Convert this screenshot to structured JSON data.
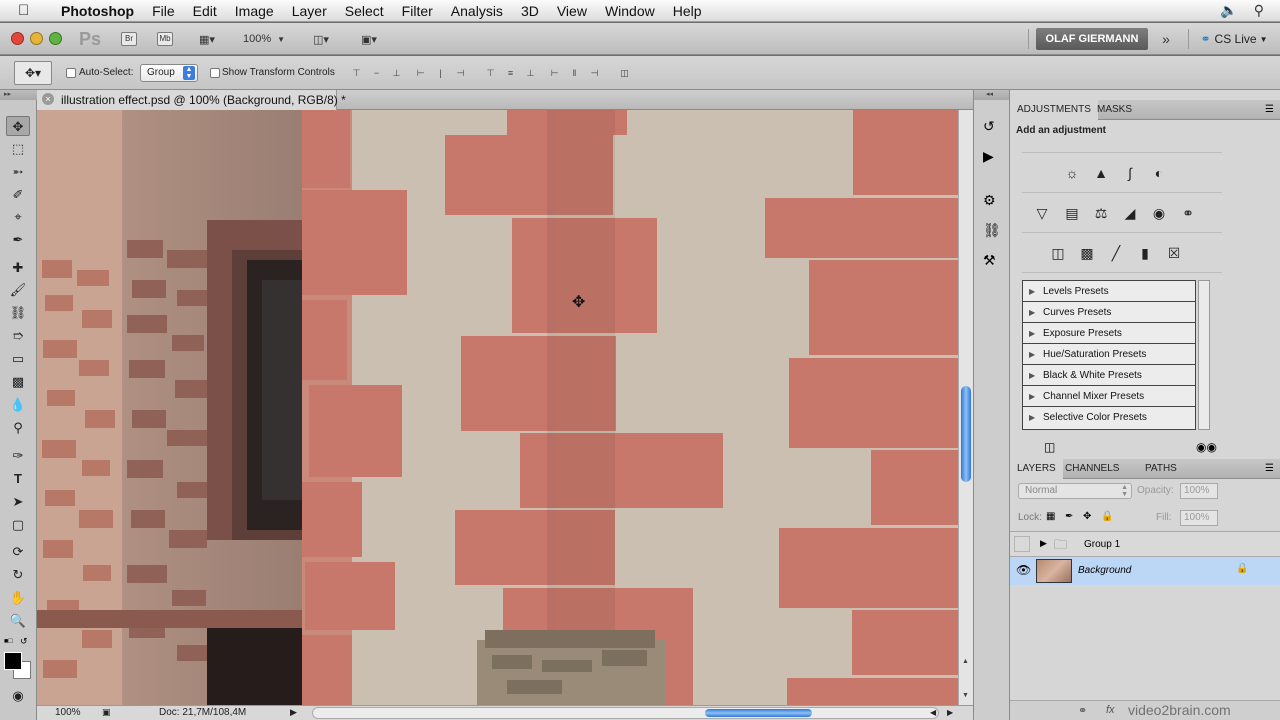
{
  "menubar": {
    "app_name": "Photoshop",
    "items": [
      "File",
      "Edit",
      "Image",
      "Layer",
      "Select",
      "Filter",
      "Analysis",
      "3D",
      "View",
      "Window",
      "Help"
    ]
  },
  "appbar": {
    "zoom": "100%",
    "user_name": "OLAF GIERMANN",
    "cs_live": "CS Live",
    "br": "Br",
    "mb": "Mb"
  },
  "options": {
    "auto_select_label": "Auto-Select:",
    "auto_select_value": "Group",
    "show_transform_label": "Show Transform Controls"
  },
  "document": {
    "tab_title": "illustration effect.psd @ 100% (Background, RGB/8) *",
    "status_zoom": "100%",
    "status_doc": "Doc: 21,7M/108,4M"
  },
  "adjustments": {
    "tabs": [
      "ADJUSTMENTS",
      "MASKS"
    ],
    "heading": "Add an adjustment",
    "presets": [
      "Levels Presets",
      "Curves Presets",
      "Exposure Presets",
      "Hue/Saturation Presets",
      "Black & White Presets",
      "Channel Mixer Presets",
      "Selective Color Presets"
    ]
  },
  "layers": {
    "tabs": [
      "LAYERS",
      "CHANNELS",
      "PATHS"
    ],
    "blend_mode": "Normal",
    "opacity_label": "Opacity:",
    "opacity_value": "100%",
    "lock_label": "Lock:",
    "fill_label": "Fill:",
    "fill_value": "100%",
    "rows": [
      {
        "name": "Group 1"
      },
      {
        "name": "Background"
      }
    ]
  },
  "watermark": "video2brain.com",
  "colors": {
    "selected_layer": "#bcd6f5",
    "sandstone": "#c4766a"
  }
}
